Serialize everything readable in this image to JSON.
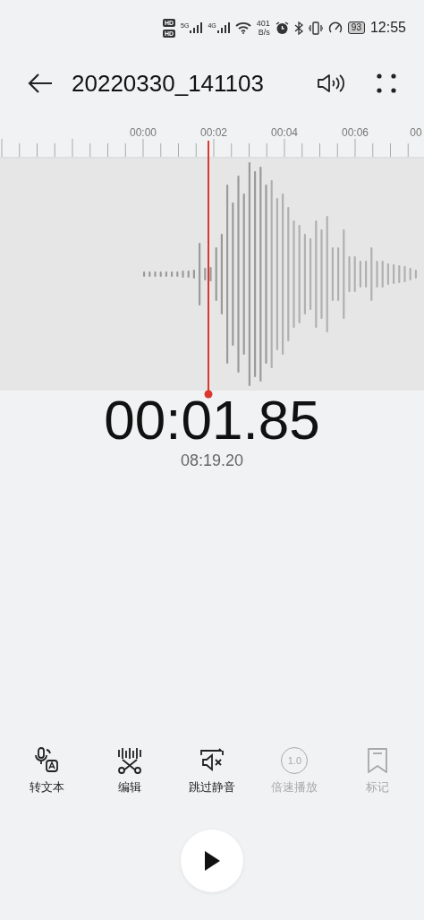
{
  "status_bar": {
    "sim_badges": [
      "HD",
      "HD"
    ],
    "networks": [
      "5G",
      "4G"
    ],
    "speed_value": "401",
    "speed_unit": "B/s",
    "battery": "93",
    "time": "12:55"
  },
  "header": {
    "title": "20220330_141103"
  },
  "ruler": {
    "labels": [
      "00:00",
      "00:02",
      "00:04",
      "00:06",
      "00"
    ]
  },
  "position": {
    "elapsed": "00:01.85",
    "duration": "08:19.20"
  },
  "toolbar": [
    {
      "kind": "transcribe",
      "label": "转文本",
      "disabled": false
    },
    {
      "kind": "edit",
      "label": "编辑",
      "disabled": false
    },
    {
      "kind": "skip-silence",
      "label": "跳过静音",
      "disabled": false
    },
    {
      "kind": "speed",
      "label": "倍速播放",
      "disabled": true,
      "icon_text": "1.0"
    },
    {
      "kind": "bookmark",
      "label": "标记",
      "disabled": true
    }
  ],
  "player": {
    "playing": false
  }
}
